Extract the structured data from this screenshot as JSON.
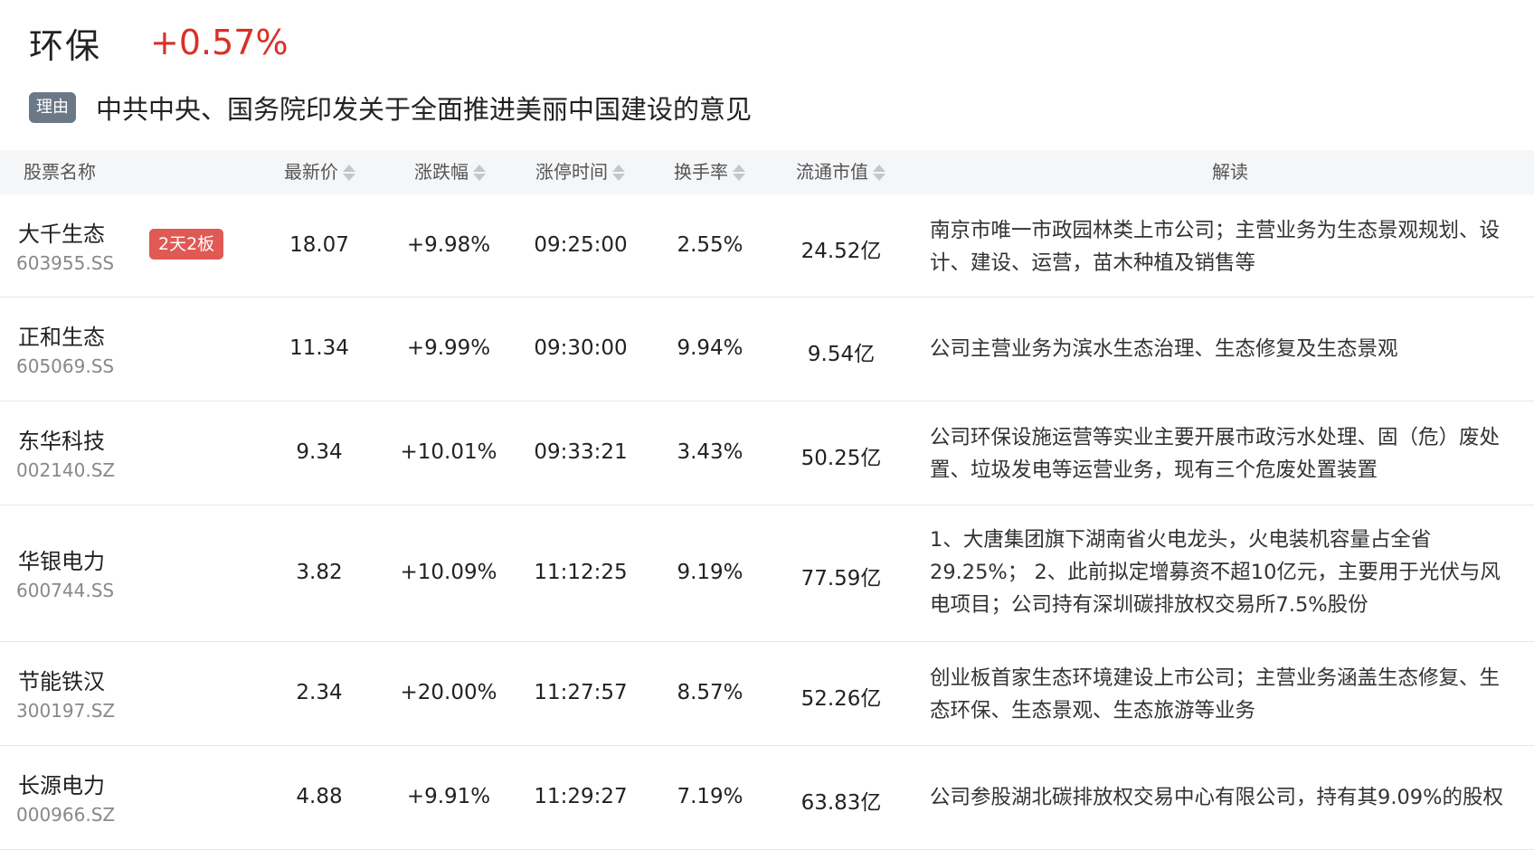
{
  "sector": {
    "name": "环保",
    "change": "+0.57%"
  },
  "reason": {
    "badge": "理由",
    "text": "中共中央、国务院印发关于全面推进美丽中国建设的意见"
  },
  "columns": {
    "name": "股票名称",
    "price": "最新价",
    "change": "涨跌幅",
    "limit_time": "涨停时间",
    "turnover": "换手率",
    "market_cap": "流通市值",
    "note": "解读"
  },
  "colors": {
    "up": "#d93026",
    "badge": "#e05a55",
    "reason_badge": "#6b7887"
  },
  "rows": [
    {
      "name": "大千生态",
      "code": "603955.SS",
      "badge": "2天2板",
      "price": "18.07",
      "change": "+9.98%",
      "time": "09:25:00",
      "turnover": "2.55%",
      "cap": "24.52亿",
      "note": "南京市唯一市政园林类上市公司；主营业务为生态景观规划、设计、建设、运营，苗木种植及销售等"
    },
    {
      "name": "正和生态",
      "code": "605069.SS",
      "badge": "",
      "price": "11.34",
      "change": "+9.99%",
      "time": "09:30:00",
      "turnover": "9.94%",
      "cap": "9.54亿",
      "note": "公司主营业务为滨水生态治理、生态修复及生态景观"
    },
    {
      "name": "东华科技",
      "code": "002140.SZ",
      "badge": "",
      "price": "9.34",
      "change": "+10.01%",
      "time": "09:33:21",
      "turnover": "3.43%",
      "cap": "50.25亿",
      "note": "公司环保设施运营等实业主要开展市政污水处理、固（危）废处置、垃圾发电等运营业务，现有三个危废处置装置"
    },
    {
      "name": "华银电力",
      "code": "600744.SS",
      "badge": "",
      "price": "3.82",
      "change": "+10.09%",
      "time": "11:12:25",
      "turnover": "9.19%",
      "cap": "77.59亿",
      "note": "1、大唐集团旗下湖南省火电龙头，火电装机容量占全省29.25%； 2、此前拟定增募资不超10亿元，主要用于光伏与风电项目；公司持有深圳碳排放权交易所7.5%股份"
    },
    {
      "name": "节能铁汉",
      "code": "300197.SZ",
      "badge": "",
      "price": "2.34",
      "change": "+20.00%",
      "time": "11:27:57",
      "turnover": "8.57%",
      "cap": "52.26亿",
      "note": "创业板首家生态环境建设上市公司；主营业务涵盖生态修复、生态环保、生态景观、生态旅游等业务"
    },
    {
      "name": "长源电力",
      "code": "000966.SZ",
      "badge": "",
      "price": "4.88",
      "change": "+9.91%",
      "time": "11:29:27",
      "turnover": "7.19%",
      "cap": "63.83亿",
      "note": "公司参股湖北碳排放权交易中心有限公司，持有其9.09%的股权"
    }
  ]
}
